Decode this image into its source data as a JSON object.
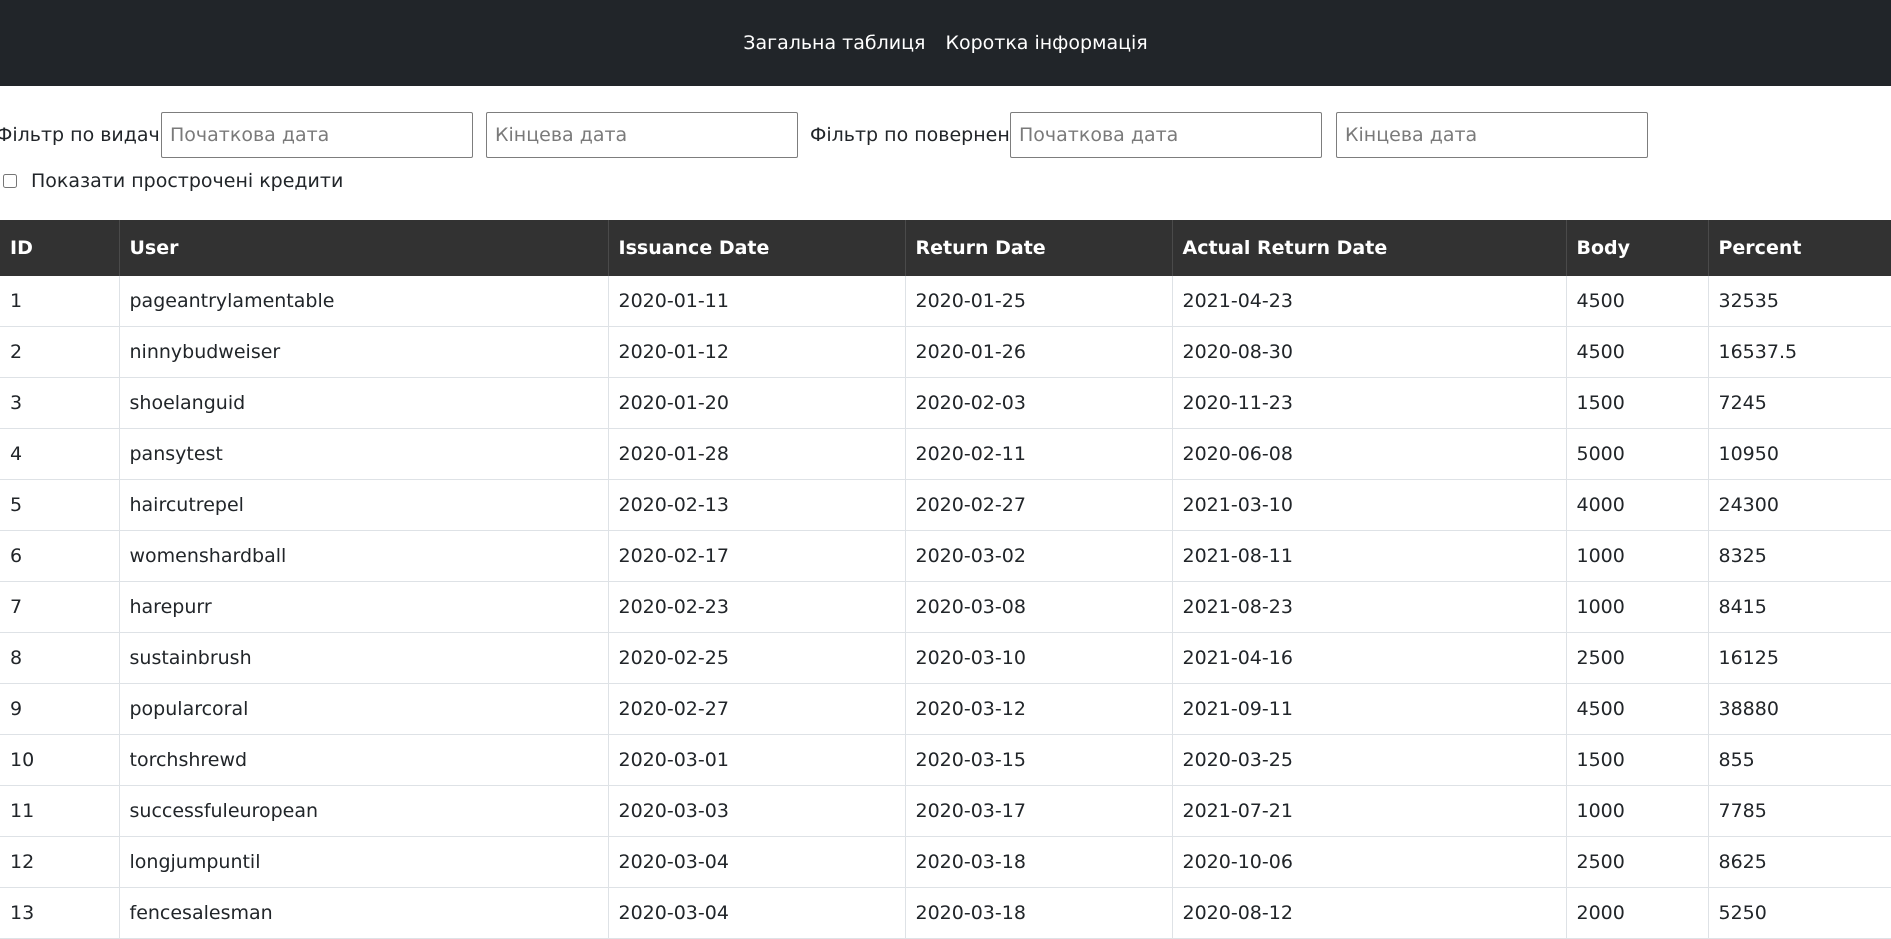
{
  "nav": {
    "links": [
      "Загальна таблиця",
      "Коротка інформація"
    ]
  },
  "filters": {
    "issuance_label": "Фільтр по видачі",
    "return_label": "Фільтр по повернені",
    "start_placeholder": "Початкова дата",
    "end_placeholder": "Кінцева дата",
    "overdue_label": "Показати прострочені кредити"
  },
  "table": {
    "columns": [
      "ID",
      "User",
      "Issuance Date",
      "Return Date",
      "Actual Return Date",
      "Body",
      "Percent"
    ],
    "rows": [
      [
        "1",
        "pageantrylamentable",
        "2020-01-11",
        "2020-01-25",
        "2021-04-23",
        "4500",
        "32535"
      ],
      [
        "2",
        "ninnybudweiser",
        "2020-01-12",
        "2020-01-26",
        "2020-08-30",
        "4500",
        "16537.5"
      ],
      [
        "3",
        "shoelanguid",
        "2020-01-20",
        "2020-02-03",
        "2020-11-23",
        "1500",
        "7245"
      ],
      [
        "4",
        "pansytest",
        "2020-01-28",
        "2020-02-11",
        "2020-06-08",
        "5000",
        "10950"
      ],
      [
        "5",
        "haircutrepel",
        "2020-02-13",
        "2020-02-27",
        "2021-03-10",
        "4000",
        "24300"
      ],
      [
        "6",
        "womenshardball",
        "2020-02-17",
        "2020-03-02",
        "2021-08-11",
        "1000",
        "8325"
      ],
      [
        "7",
        "harepurr",
        "2020-02-23",
        "2020-03-08",
        "2021-08-23",
        "1000",
        "8415"
      ],
      [
        "8",
        "sustainbrush",
        "2020-02-25",
        "2020-03-10",
        "2021-04-16",
        "2500",
        "16125"
      ],
      [
        "9",
        "popularcoral",
        "2020-02-27",
        "2020-03-12",
        "2021-09-11",
        "4500",
        "38880"
      ],
      [
        "10",
        "torchshrewd",
        "2020-03-01",
        "2020-03-15",
        "2020-03-25",
        "1500",
        "855"
      ],
      [
        "11",
        "successfuleuropean",
        "2020-03-03",
        "2020-03-17",
        "2021-07-21",
        "1000",
        "7785"
      ],
      [
        "12",
        "longjumpuntil",
        "2020-03-04",
        "2020-03-18",
        "2020-10-06",
        "2500",
        "8625"
      ],
      [
        "13",
        "fencesalesman",
        "2020-03-04",
        "2020-03-18",
        "2020-08-12",
        "2000",
        "5250"
      ]
    ]
  }
}
